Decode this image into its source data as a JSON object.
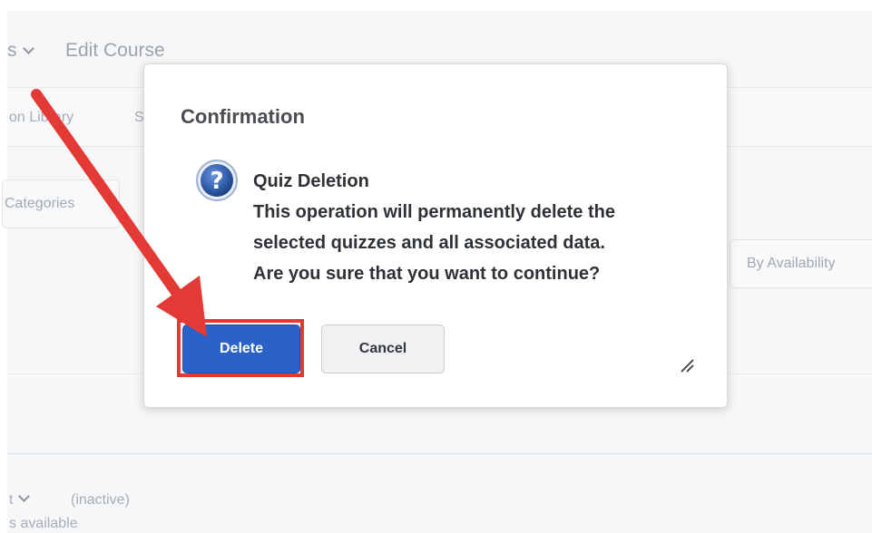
{
  "background": {
    "nav_left": "s",
    "nav_title": "Edit Course",
    "tab_partial_1": "on Library",
    "tab_partial_2": "S",
    "categories_btn": "Categories",
    "availability_btn": "By Availability",
    "row_left": "t",
    "row_status": "(inactive)",
    "row_sub": "s available"
  },
  "dialog": {
    "title": "Confirmation",
    "message_heading": "Quiz Deletion",
    "message_lines": [
      "This operation will permanently delete the",
      "selected quizzes and all associated data.",
      "Are you sure that you want to continue?"
    ],
    "delete_label": "Delete",
    "cancel_label": "Cancel"
  },
  "colors": {
    "primary": "#2a62c9",
    "annotation": "#e33a36"
  },
  "icons": [
    "question-icon",
    "resize-handle-icon",
    "chevron-down-icon",
    "arrow-annotation"
  ]
}
